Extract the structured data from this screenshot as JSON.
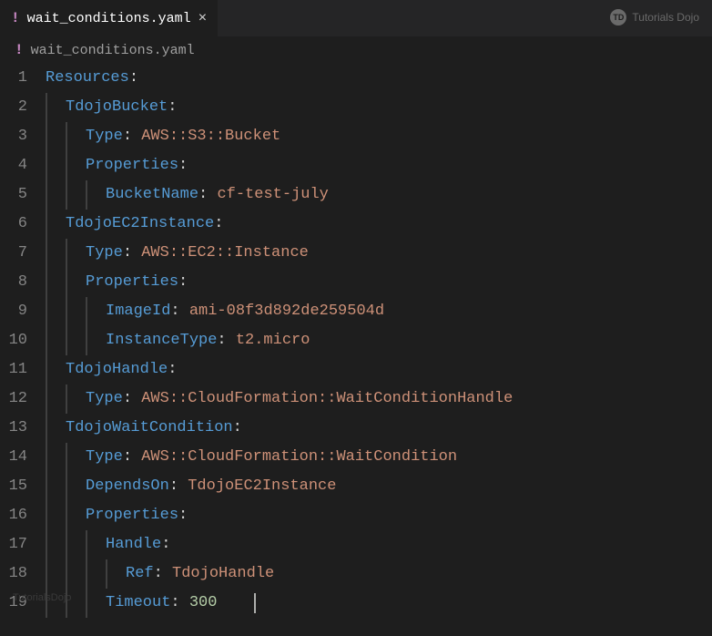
{
  "tab": {
    "filename": "wait_conditions.yaml",
    "close_glyph": "×"
  },
  "breadcrumb": {
    "filename": "wait_conditions.yaml"
  },
  "watermark": {
    "badge": "TD",
    "text": "Tutorials Dojo",
    "bottom": "TutorialsDojo"
  },
  "lines": {
    "1": {
      "no": "1",
      "k": "Resources",
      "c": ":"
    },
    "2": {
      "no": "2",
      "k": "TdojoBucket",
      "c": ":"
    },
    "3": {
      "no": "3",
      "k": "Type",
      "c": ": ",
      "v": "AWS::S3::Bucket"
    },
    "4": {
      "no": "4",
      "k": "Properties",
      "c": ":"
    },
    "5": {
      "no": "5",
      "k": "BucketName",
      "c": ": ",
      "v": "cf-test-july"
    },
    "6": {
      "no": "6",
      "k": "TdojoEC2Instance",
      "c": ":"
    },
    "7": {
      "no": "7",
      "k": "Type",
      "c": ": ",
      "v": "AWS::EC2::Instance"
    },
    "8": {
      "no": "8",
      "k": "Properties",
      "c": ":"
    },
    "9": {
      "no": "9",
      "k": "ImageId",
      "c": ": ",
      "v": "ami-08f3d892de259504d"
    },
    "10": {
      "no": "10",
      "k": "InstanceType",
      "c": ": ",
      "v": "t2.micro"
    },
    "11": {
      "no": "11",
      "k": "TdojoHandle",
      "c": ":"
    },
    "12": {
      "no": "12",
      "k": "Type",
      "c": ": ",
      "v": "AWS::CloudFormation::WaitConditionHandle"
    },
    "13": {
      "no": "13",
      "k": "TdojoWaitCondition",
      "c": ":"
    },
    "14": {
      "no": "14",
      "k": "Type",
      "c": ": ",
      "v": "AWS::CloudFormation::WaitCondition"
    },
    "15": {
      "no": "15",
      "k": "DependsOn",
      "c": ": ",
      "v": "TdojoEC2Instance"
    },
    "16": {
      "no": "16",
      "k": "Properties",
      "c": ":"
    },
    "17": {
      "no": "17",
      "k": "Handle",
      "c": ":"
    },
    "18": {
      "no": "18",
      "k": "Ref",
      "c": ": ",
      "v": "TdojoHandle"
    },
    "19": {
      "no": "19",
      "k": "Timeout",
      "c": ": ",
      "v": "300"
    }
  }
}
